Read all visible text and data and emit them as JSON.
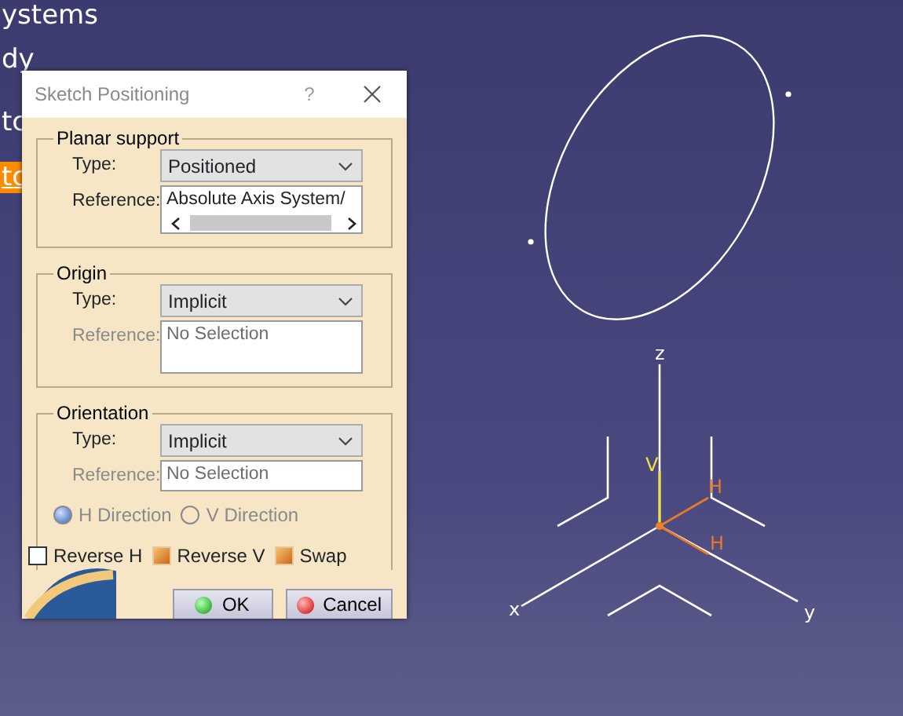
{
  "tree": [
    {
      "label": "ystems",
      "selected": false
    },
    {
      "label": "dy",
      "selected": false
    },
    {
      "label": "tc",
      "selected": false
    },
    {
      "label": "tc",
      "selected": true
    }
  ],
  "dialog": {
    "title": "Sketch Positioning",
    "help": "?",
    "groups": [
      {
        "title": "Planar support",
        "type_label": "Type:",
        "type_value": "Positioned",
        "reference_label": "Reference:",
        "reference_value": "Absolute Axis System/",
        "reference_disabled": false,
        "kind": "scroll"
      },
      {
        "title": "Origin",
        "type_label": "Type:",
        "type_value": "Implicit",
        "reference_label": "Reference:",
        "reference_value": "No Selection",
        "reference_disabled": true,
        "kind": "tall"
      },
      {
        "title": "Orientation",
        "type_label": "Type:",
        "type_value": "Implicit",
        "reference_label": "Reference:",
        "reference_value": "No Selection",
        "reference_disabled": true,
        "kind": "single"
      }
    ],
    "radios": [
      {
        "label": "H Direction",
        "selected": true,
        "disabled": true
      },
      {
        "label": "V Direction",
        "selected": false,
        "disabled": true
      }
    ],
    "checkboxes": [
      {
        "label": "Reverse H",
        "checked": false
      },
      {
        "label": "Reverse V",
        "checked": true
      },
      {
        "label": "Swap",
        "checked": true
      }
    ],
    "buttons": [
      {
        "label": "OK",
        "kind": "ok"
      },
      {
        "label": "Cancel",
        "kind": "cancel"
      }
    ]
  },
  "axis_labels": [
    {
      "text": "z",
      "kind": "axis"
    },
    {
      "text": "V",
      "kind": "v"
    },
    {
      "text": "H",
      "kind": "h"
    },
    {
      "text": "H",
      "kind": "h"
    },
    {
      "text": "x",
      "kind": "axis"
    },
    {
      "text": "y",
      "kind": "axis"
    }
  ]
}
